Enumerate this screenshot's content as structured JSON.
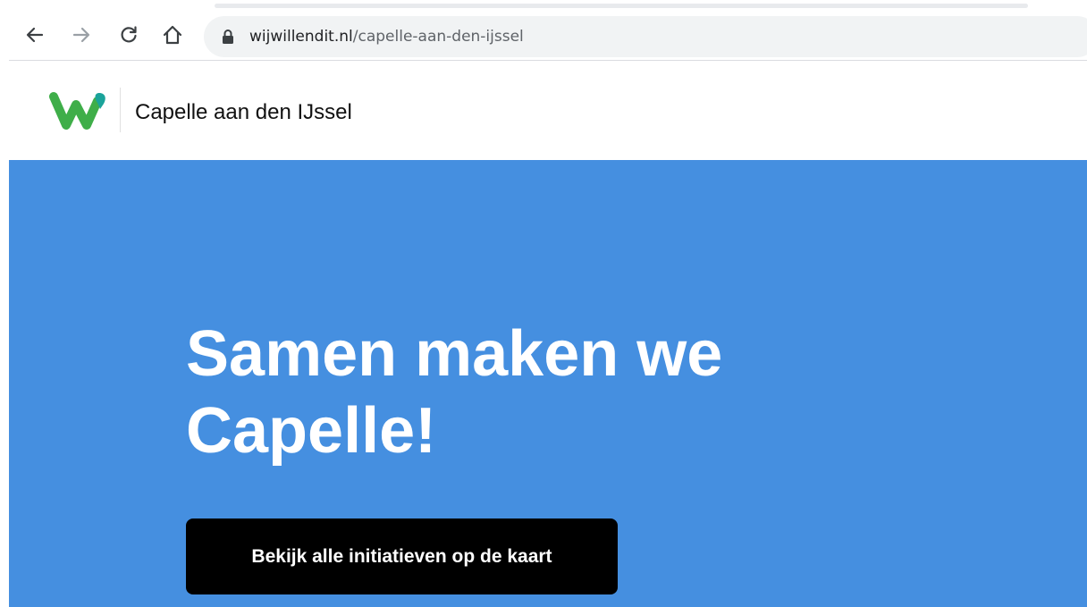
{
  "browser": {
    "back_icon": "back-arrow-icon",
    "forward_icon": "forward-arrow-icon",
    "reload_icon": "reload-icon",
    "home_icon": "home-icon",
    "lock_icon": "lock-icon",
    "url_domain": "wijwillendit.nl",
    "url_path": "/capelle-aan-den-ijssel"
  },
  "header": {
    "logo_icon": "wijwillendit-logo",
    "site_title": "Capelle aan den IJssel"
  },
  "hero": {
    "background_color": "#458fe0",
    "heading_line1": "Samen maken we",
    "heading_line2": "Capelle!",
    "cta_label": "Bekijk alle initiatieven op de kaart"
  },
  "colors": {
    "logo_green": "#3fae49",
    "logo_teal": "#1aa39a",
    "cta_background": "#000000"
  }
}
